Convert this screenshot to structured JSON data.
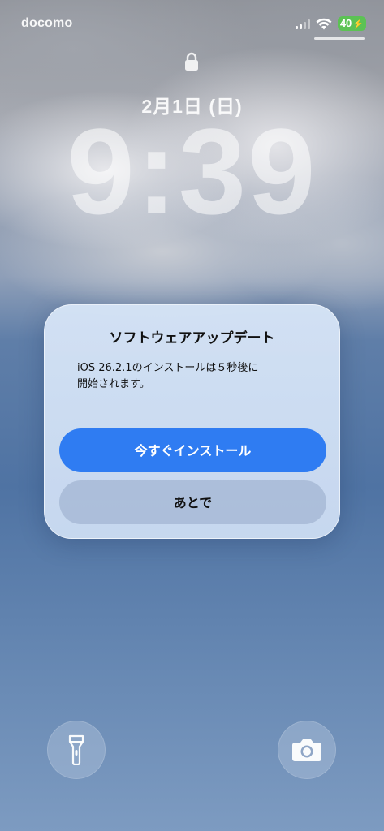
{
  "status_bar": {
    "carrier": "docomo",
    "battery_level": "40",
    "battery_charging": true,
    "battery_color": "#5cc254",
    "signal_icon": "cellular-signal-icon",
    "wifi_icon": "wifi-icon"
  },
  "lock_screen": {
    "lock_icon": "lock-icon",
    "date": "2月1日 (日)",
    "time": "9:39"
  },
  "alert": {
    "title": "ソフトウェアアップデート",
    "message_line1": "iOS 26.2.1のインストールは５秒後に",
    "message_line2": "開始されます。",
    "primary_button": "今すぐインストール",
    "secondary_button": "あとで",
    "primary_color": "#2f7cf2"
  },
  "quick_actions": {
    "flashlight_icon": "flashlight-icon",
    "camera_icon": "camera-icon"
  }
}
